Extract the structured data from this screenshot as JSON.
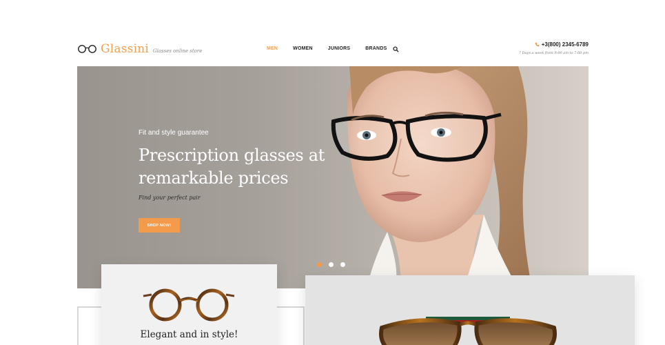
{
  "brand": {
    "name": "Glassini",
    "tagline": "Glasses online store",
    "accent_color": "#f4a04b"
  },
  "nav": {
    "items": [
      {
        "label": "MEN",
        "active": true
      },
      {
        "label": "WOMEN",
        "active": false
      },
      {
        "label": "JUNIORS",
        "active": false
      },
      {
        "label": "BRANDS",
        "active": false
      }
    ],
    "search_icon": "search-icon"
  },
  "contact": {
    "phone": "+3(800) 2345-6789",
    "hours": "7 Days a week from 9:00 am to 7:00 pm",
    "phone_icon": "phone-icon"
  },
  "hero": {
    "kicker": "Fit and style guarantee",
    "title": "Prescription glasses at remarkable prices",
    "subtitle": "Find your perfect pair",
    "button_label": "SHOP NOW!",
    "slides": 3,
    "active_slide": 1
  },
  "cards": {
    "left_title": "Elegant and in style!"
  }
}
